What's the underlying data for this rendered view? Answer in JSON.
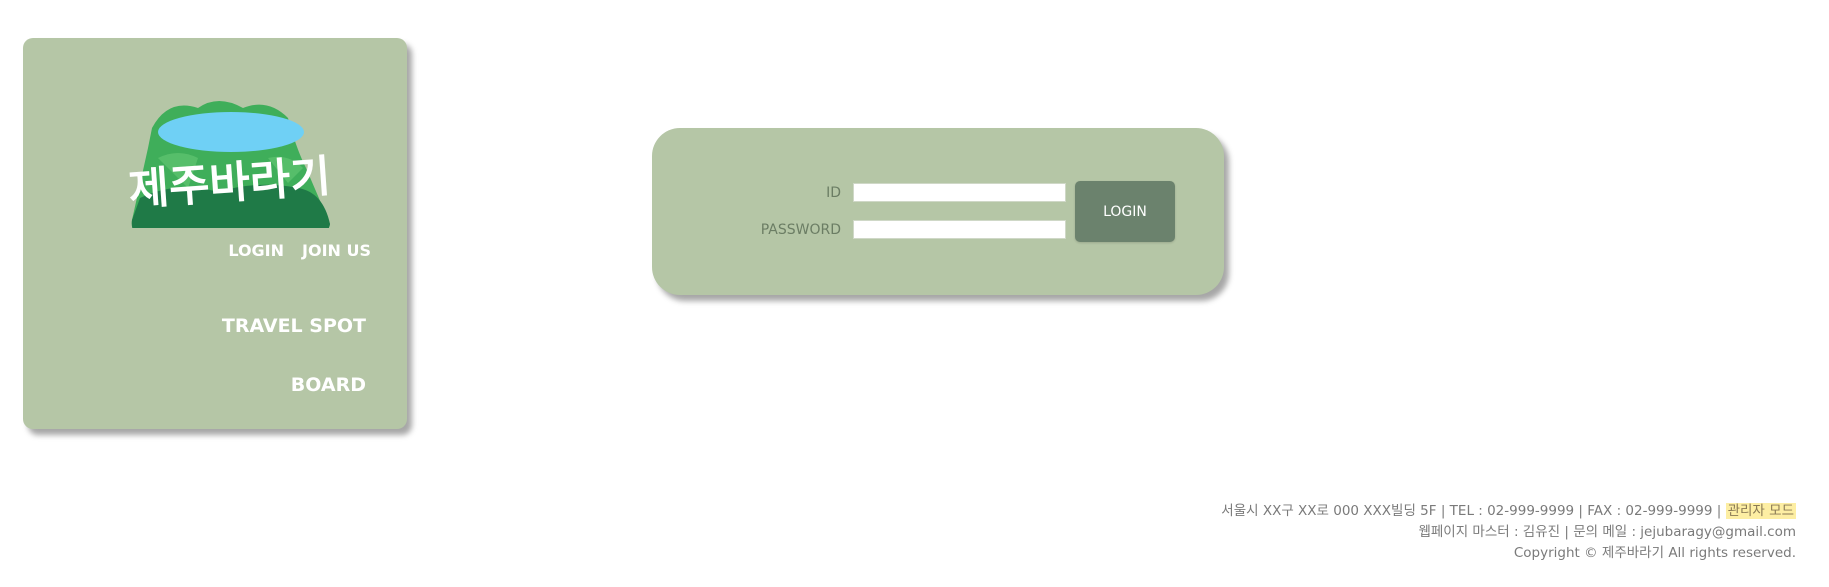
{
  "colors": {
    "panel_bg": "#b5c6a6",
    "button_bg": "#6b826d",
    "text_light": "#ffffff",
    "label_text": "#6b7d64",
    "footer_text": "#7a7a7a",
    "admin_highlight": "#fdeea3"
  },
  "sidebar": {
    "logo_text": "제주바라기",
    "auth": {
      "login": "LOGIN",
      "join": "JOIN US"
    },
    "nav": {
      "travel_spot": "TRAVEL SPOT",
      "board": "BOARD"
    }
  },
  "login_form": {
    "id_label": "ID",
    "password_label": "PASSWORD",
    "id_value": "",
    "password_value": "",
    "submit_label": "LOGIN"
  },
  "footer": {
    "line1_text": "서울시 XX구 XX로 000 XXX빌딩 5F | TEL : 02-999-9999 | FAX : 02-999-9999 |",
    "admin_mode": "관리자 모드",
    "line2": "웹페이지 마스터 : 김유진 | 문의 메일 : jejubaragy@gmail.com",
    "line3": "Copyright © 제주바라기 All rights reserved."
  }
}
